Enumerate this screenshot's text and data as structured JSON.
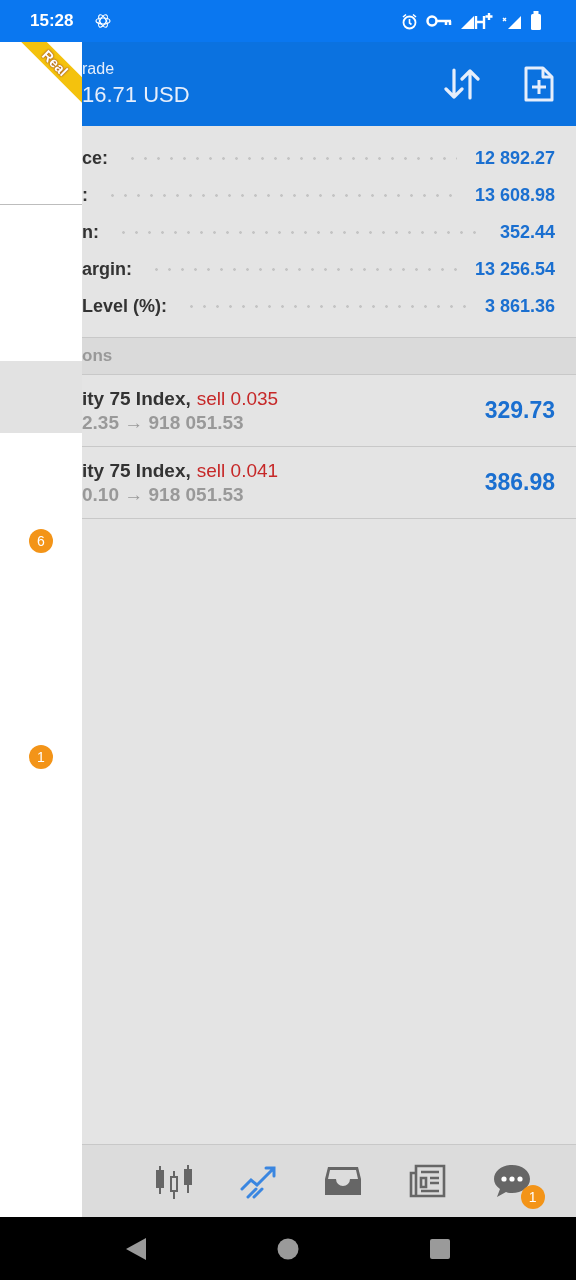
{
  "status_bar": {
    "time": "15:28"
  },
  "drawer": {
    "ribbon": "Real",
    "items": [
      {
        "selected": false
      },
      {
        "selected": false
      },
      {
        "selected": true
      },
      {
        "selected": false
      },
      {
        "selected": false,
        "counter": "6"
      },
      {
        "selected": false
      },
      {
        "selected": false
      },
      {
        "selected": false,
        "counter": "1"
      }
    ]
  },
  "header": {
    "title": "rade",
    "balance": "16.71 USD"
  },
  "summary": [
    {
      "label": "ce:",
      "value": "12 892.27"
    },
    {
      "label": ":",
      "value": "13 608.98"
    },
    {
      "label": "n:",
      "value": "352.44"
    },
    {
      "label": "argin:",
      "value": "13 256.54"
    },
    {
      "label": "Level (%):",
      "value": "3 861.36"
    }
  ],
  "positions": {
    "title": "ons",
    "items": [
      {
        "symbol": "ity 75 Index,",
        "order": "sell 0.035",
        "prices": "2.35 → 918 051.53",
        "profit": "329.73"
      },
      {
        "symbol": "ity 75 Index,",
        "order": "sell 0.041",
        "prices": "0.10 → 918 051.53",
        "profit": "386.98"
      }
    ]
  },
  "tabs": [
    {
      "kind": "quotes",
      "selected": false
    },
    {
      "kind": "trade",
      "selected": true
    },
    {
      "kind": "history",
      "selected": false
    },
    {
      "kind": "news",
      "selected": false
    },
    {
      "kind": "chat",
      "selected": false,
      "badge": "1"
    }
  ]
}
